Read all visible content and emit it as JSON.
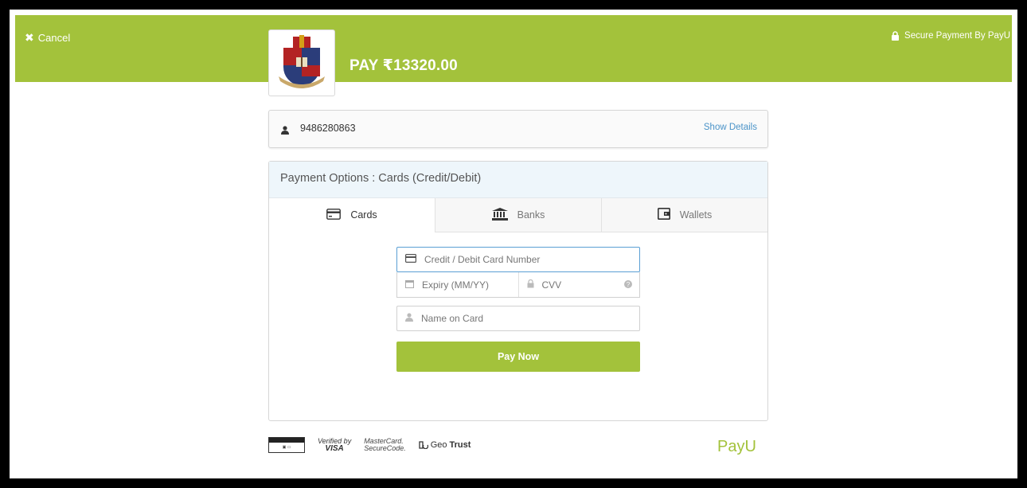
{
  "header": {
    "cancel_label": "Cancel",
    "secure_label": "Secure Payment By PayU",
    "pay_title": "PAY ₹13320.00",
    "accent_color": "#a3c23b"
  },
  "user": {
    "phone": "9486280863",
    "show_details": "Show Details"
  },
  "payment": {
    "options_title": "Payment Options : Cards (Credit/Debit)",
    "tabs": [
      {
        "label": "Cards",
        "icon": "card-icon",
        "active": true
      },
      {
        "label": "Banks",
        "icon": "bank-icon",
        "active": false
      },
      {
        "label": "Wallets",
        "icon": "wallet-icon",
        "active": false
      }
    ],
    "card_number_placeholder": "Credit / Debit Card Number",
    "expiry_placeholder": "Expiry (MM/YY)",
    "cvv_placeholder": "CVV",
    "name_placeholder": "Name on Card",
    "pay_button": "Pay Now"
  },
  "footer": {
    "verified_by": "Verified by",
    "visa": "VISA",
    "mastercard": "MasterCard.",
    "securecode": "SecureCode.",
    "geo": "Geo",
    "trust": "Trust",
    "payu_logo": "PayU"
  }
}
